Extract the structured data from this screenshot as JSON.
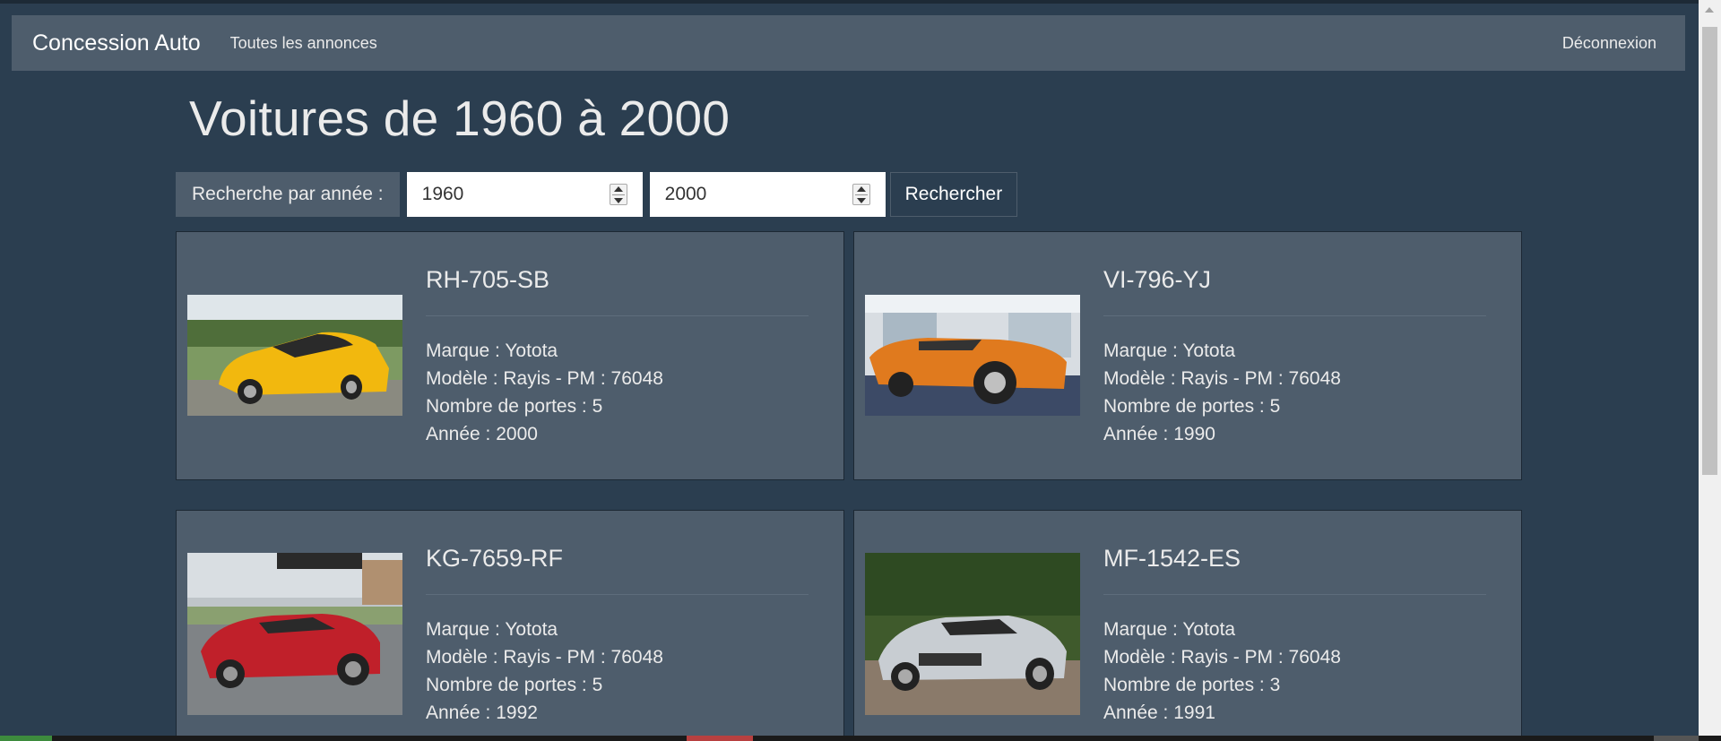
{
  "navbar": {
    "brand": "Concession Auto",
    "link_all": "Toutes les annonces",
    "logout": "Déconnexion"
  },
  "page": {
    "title": "Voitures de 1960 à 2000"
  },
  "search": {
    "label": "Recherche par année :",
    "year_from": "1960",
    "year_to": "2000",
    "button": "Rechercher"
  },
  "cars": [
    {
      "plate": "RH-705-SB",
      "marque": "Marque : Yotota",
      "modele": "Modèle : Rayis - PM : 76048",
      "portes": "Nombre de portes : 5",
      "annee": "Année : 2000",
      "image": "yellow-sports-car"
    },
    {
      "plate": "VI-796-YJ",
      "marque": "Marque : Yotota",
      "modele": "Modèle : Rayis - PM : 76048",
      "portes": "Nombre de portes : 5",
      "annee": "Année : 1990",
      "image": "orange-roadster-showroom"
    },
    {
      "plate": "KG-7659-RF",
      "marque": "Marque : Yotota",
      "modele": "Modèle : Rayis - PM : 76048",
      "portes": "Nombre de portes : 5",
      "annee": "Année : 1992",
      "image": "red-grand-tourer"
    },
    {
      "plate": "MF-1542-ES",
      "marque": "Marque : Yotota",
      "modele": "Modèle : Rayis - PM : 76048",
      "portes": "Nombre de portes : 3",
      "annee": "Année : 1991",
      "image": "silver-concept-car"
    }
  ],
  "colors": {
    "background": "#2b3e50",
    "panel": "#4e5d6c",
    "text": "#ebebeb"
  }
}
